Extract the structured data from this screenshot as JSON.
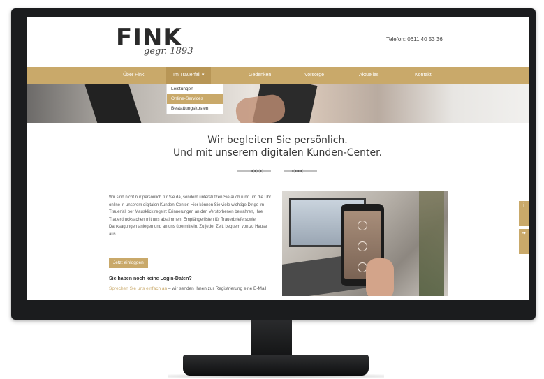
{
  "site": {
    "logo_word": "FINK",
    "logo_tagline": "gegr. 1893",
    "phone": "Telefon: 0611 40 53 36"
  },
  "nav": {
    "items": [
      {
        "label": "Über Fink"
      },
      {
        "label": "Im Trauerfall ▾"
      },
      {
        "label": "Gedenken"
      },
      {
        "label": "Vorsorge"
      },
      {
        "label": "Aktuelles"
      },
      {
        "label": "Kontakt"
      }
    ],
    "dropdown": [
      {
        "label": "Leistungen"
      },
      {
        "label": "Online-Services"
      },
      {
        "label": "Bestattungskosten"
      }
    ]
  },
  "main": {
    "headline_1": "Wir begleiten Sie persönlich.",
    "headline_2": "Und mit unserem digitalen Kunden-Center.",
    "intro": "Wir sind nicht nur persönlich für Sie da, sondern unterstützen Sie auch rund um die Uhr online in unserem digitalen Kunden-Center. Hier können Sie viele wichtige Dinge im Trauerfall per Mausklick regeln: Erinnerungen an den Verstorbenen bewahren, Ihre Trauerdrucksachen mit uns abstimmen, Empfängerlisten für Trauerbriefe sowie Danksagungen anlegen und an uns übermitteln. Zu jeder Zeit, bequem von zu Hause aus.",
    "login_button": "Jetzt einloggen",
    "nologin_title": "Sie haben noch keine Login-Daten?",
    "nologin_link": "Sprechen Sie uns einfach an",
    "nologin_rest": " – wir senden Ihnen zur Registrierung eine E-Mail."
  },
  "colors": {
    "accent": "#c9a96a",
    "bezel": "#1b1c1e"
  }
}
